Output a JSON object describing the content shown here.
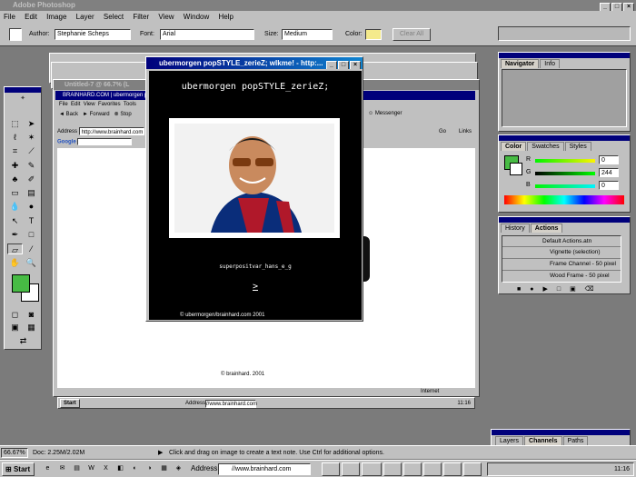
{
  "app": {
    "title": "Adobe Photoshop"
  },
  "menubar": [
    "File",
    "Edit",
    "Image",
    "Layer",
    "Select",
    "Filter",
    "View",
    "Window",
    "Help"
  ],
  "options": {
    "author_label": "Author:",
    "author_value": "Stephanie Scheps",
    "font_label": "Font:",
    "font_value": "Arial",
    "size_label": "Size:",
    "size_value": "Medium",
    "color_label": "Color:",
    "color_value": "#f4ea8c",
    "clear_all": "Clear All"
  },
  "bg_document": {
    "title": "Untitled-7 @ 66.7% (L",
    "browser_title": "BRAINHARD.COM | ubermorgen popSTYLE_zerieZ - Microsoft Internet Explorer",
    "menus": [
      "File",
      "Edit",
      "View",
      "Favorites",
      "Tools"
    ],
    "toolbar": [
      "Back",
      "Forward",
      "Stop"
    ],
    "address_label": "Address",
    "address_value": "http://www.brainhard.com",
    "go": "Go",
    "links": "Links",
    "messenger": "Messenger",
    "google_label": "Google",
    "footer": "© brainhard.  2001",
    "status": "Internet",
    "taskbar": {
      "start": "Start",
      "address_label": "Address",
      "address_value": "//www.brainhard.com",
      "clock": "11:16"
    }
  },
  "popup": {
    "title": "ubermorgen popSTYLE_zerieZ; wlkme! - http:...",
    "heading": "ubermorgen popSTYLE_zerieZ;",
    "caption": "superpositvar_hans_e_g",
    "link": ">",
    "footer": "© ubermorgen/brainhard.com  2001"
  },
  "panels": {
    "navigator": {
      "tabs": [
        "Navigator",
        "Info"
      ]
    },
    "color": {
      "tabs": [
        "Color",
        "Swatches",
        "Styles"
      ],
      "r_label": "R",
      "r_value": "0",
      "g_label": "G",
      "g_value": "244",
      "b_label": "B",
      "b_value": "0",
      "swatch": "#47bb44"
    },
    "actions": {
      "tabs": [
        "History",
        "Actions"
      ],
      "items": [
        "Default Actions.atn",
        "Vignette (selection)",
        "Frame Channel - 50 pixel",
        "Wood Frame - 50 pixel"
      ]
    },
    "layers": {
      "tabs": [
        "Layers",
        "Channels",
        "Paths"
      ]
    }
  },
  "statusbar": {
    "zoom": "66.67%",
    "doc": "Doc: 2.25M/2.02M",
    "hint": "Click and drag on image to create a text note. Use Ctrl for additional options."
  },
  "taskbar": {
    "start": "Start",
    "address_label": "Address",
    "address_value": "//www.brainhard.com",
    "clock": "11:16"
  }
}
